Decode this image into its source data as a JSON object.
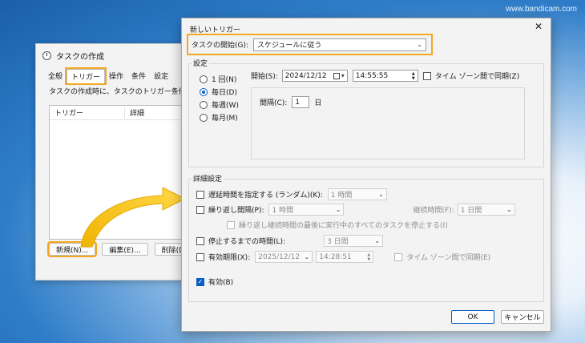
{
  "watermark": "www.bandicam.com",
  "back_window": {
    "title": "タスクの作成",
    "tabs": [
      "全般",
      "トリガー",
      "操作",
      "条件",
      "設定"
    ],
    "description": "タスクの作成時に、タスクのトリガー条件を指定で",
    "columns": [
      "トリガー",
      "詳細"
    ],
    "buttons": {
      "new": "新規(N)...",
      "edit": "編集(E)...",
      "delete": "削除(D)"
    }
  },
  "dialog": {
    "title": "新しいトリガー",
    "close_glyph": "✕",
    "begin_label": "タスクの開始(G):",
    "begin_value": "スケジュールに従う",
    "settings_label": "設定",
    "radios": [
      "1 回(N)",
      "毎日(D)",
      "毎週(W)",
      "毎月(M)"
    ],
    "start_label": "開始(S):",
    "start_date": "2024/12/12",
    "start_time": "14:55:55",
    "tz_label": "タイム ゾーン間で同期(Z)",
    "interval_label": "間隔(C):",
    "interval_value": "1",
    "interval_unit": "日",
    "advanced_label": "詳細設定",
    "delay_label": "遅延時間を指定する (ランダム)(K):",
    "delay_value": "1 時間",
    "repeat_label": "繰り返し間隔(P):",
    "repeat_value": "1 時間",
    "duration_label": "継続時間(F):",
    "duration_value": "1 日間",
    "stop_all_label": "繰り返し継続時間の最後に実行中のすべてのタスクを停止する(I)",
    "stop_after_label": "停止するまでの時間(L):",
    "stop_after_value": "3 日間",
    "expire_label": "有効期限(X):",
    "expire_date": "2025/12/12",
    "expire_time": "14:28:51",
    "expire_tz_label": "タイム ゾーン間で同期(E)",
    "enabled_label": "有効(B)",
    "ok": "OK",
    "cancel": "キャンセル"
  }
}
